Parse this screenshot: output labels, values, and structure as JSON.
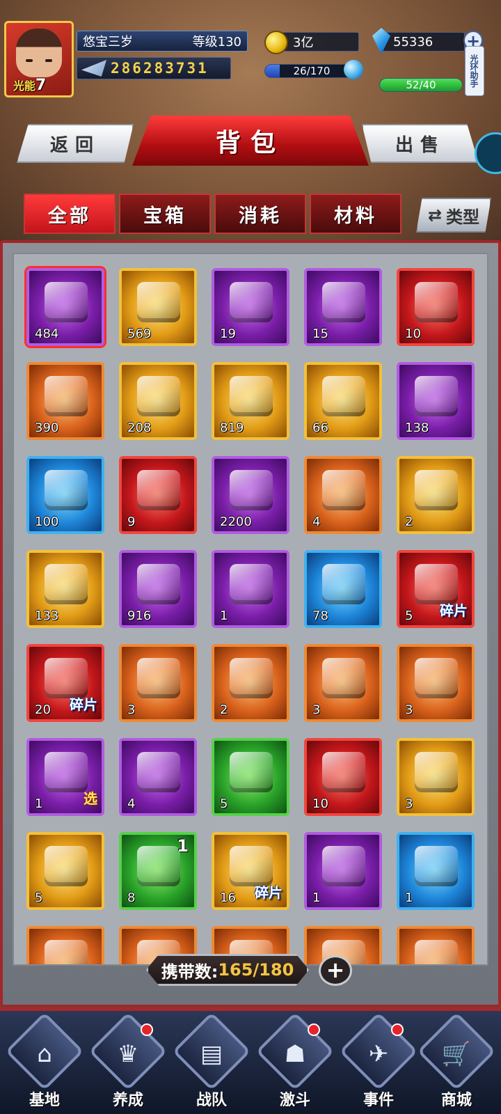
{
  "player": {
    "name": "悠宝三岁",
    "level": "等级130",
    "id": "286283731",
    "energy_label": "光能",
    "energy_value": "7"
  },
  "resources": {
    "gold": "3亿",
    "diamonds": "55336",
    "stamina": "26/170",
    "stamina_fraction": 0.153,
    "energy_bar": "52/40",
    "energy_fraction": 1.0,
    "helper_label": "光环助手"
  },
  "header": {
    "back": "返回",
    "title": "背包",
    "sell": "出售"
  },
  "tabs": [
    {
      "label": "全部",
      "active": true
    },
    {
      "label": "宝箱",
      "active": false
    },
    {
      "label": "消耗",
      "active": false
    },
    {
      "label": "材料",
      "active": false
    }
  ],
  "type_button": "类型",
  "items": [
    {
      "rarity": "purple",
      "count": "484",
      "icon": "toolbox-icon",
      "selected": true
    },
    {
      "rarity": "gold",
      "count": "569",
      "icon": "bag-icon"
    },
    {
      "rarity": "purple",
      "count": "19",
      "icon": "gift-box-icon"
    },
    {
      "rarity": "purple",
      "count": "15",
      "icon": "gift-icon"
    },
    {
      "rarity": "red",
      "count": "10",
      "icon": "fire-orb-icon"
    },
    {
      "rarity": "orange",
      "count": "390",
      "icon": "gold-crate-icon"
    },
    {
      "rarity": "gold",
      "count": "208",
      "icon": "blueprint-icon"
    },
    {
      "rarity": "gold",
      "count": "819",
      "icon": "claw-card-icon"
    },
    {
      "rarity": "gold",
      "count": "66",
      "icon": "sack-icon"
    },
    {
      "rarity": "purple",
      "count": "138",
      "icon": "sack-icon"
    },
    {
      "rarity": "blue",
      "count": "100",
      "icon": "sack-icon"
    },
    {
      "rarity": "red",
      "count": "9",
      "icon": "crate-icon"
    },
    {
      "rarity": "purple",
      "count": "2200",
      "icon": "cage-icon"
    },
    {
      "rarity": "orange",
      "count": "4",
      "icon": "chest-icon"
    },
    {
      "rarity": "gold",
      "count": "2",
      "icon": "chest-icon"
    },
    {
      "rarity": "gold",
      "count": "133",
      "icon": "key-icon"
    },
    {
      "rarity": "purple",
      "count": "916",
      "icon": "chest-icon"
    },
    {
      "rarity": "purple",
      "count": "1",
      "icon": "key-icon"
    },
    {
      "rarity": "blue",
      "count": "78",
      "icon": "chest-icon"
    },
    {
      "rarity": "red",
      "count": "5",
      "badge": "碎片",
      "icon": "helmet-icon"
    },
    {
      "rarity": "red",
      "count": "20",
      "badge": "碎片",
      "icon": "mech-head-icon"
    },
    {
      "rarity": "orange",
      "count": "3",
      "icon": "crate-icon"
    },
    {
      "rarity": "orange",
      "count": "2",
      "icon": "chest-icon"
    },
    {
      "rarity": "orange",
      "count": "3",
      "icon": "chest-icon"
    },
    {
      "rarity": "orange",
      "count": "3",
      "icon": "crate-icon"
    },
    {
      "rarity": "purple",
      "count": "1",
      "badge_select": "选",
      "icon": "case-icon"
    },
    {
      "rarity": "purple",
      "count": "4",
      "icon": "case-icon"
    },
    {
      "rarity": "green",
      "count": "5",
      "icon": "case-icon"
    },
    {
      "rarity": "red",
      "count": "10",
      "icon": "tag-icon"
    },
    {
      "rarity": "gold",
      "count": "3",
      "icon": "crate-icon"
    },
    {
      "rarity": "gold",
      "count": "5",
      "icon": "chip-icon"
    },
    {
      "rarity": "green",
      "count": "8",
      "corner": "1",
      "icon": "gift-box-icon"
    },
    {
      "rarity": "gold",
      "count": "16",
      "badge": "碎片",
      "icon": "chest-icon"
    },
    {
      "rarity": "purple",
      "count": "1",
      "icon": "crystal-icon"
    },
    {
      "rarity": "blue",
      "count": "1",
      "icon": "crystal-icon"
    },
    {
      "rarity": "orange",
      "count": "",
      "icon": "ruby-icon"
    },
    {
      "rarity": "orange",
      "count": "",
      "icon": "lightning-icon"
    },
    {
      "rarity": "orange",
      "count": "",
      "icon": "flame-icon"
    },
    {
      "rarity": "orange",
      "count": "",
      "icon": "pyramid-icon"
    },
    {
      "rarity": "orange",
      "count": "",
      "icon": "box-icon"
    }
  ],
  "capacity": {
    "label": "携带数:",
    "value": "165/180"
  },
  "nav": [
    {
      "label": "基地",
      "icon": "base-icon",
      "dot": false
    },
    {
      "label": "养成",
      "icon": "trophy-icon",
      "dot": true
    },
    {
      "label": "战队",
      "icon": "cards-icon",
      "dot": false
    },
    {
      "label": "激斗",
      "icon": "helmet-icon",
      "dot": true
    },
    {
      "label": "事件",
      "icon": "jet-icon",
      "dot": true
    },
    {
      "label": "商城",
      "icon": "cart-icon",
      "dot": false
    }
  ],
  "colors": {
    "accent_red": "#c3151b",
    "gold_text": "#f4c443"
  }
}
